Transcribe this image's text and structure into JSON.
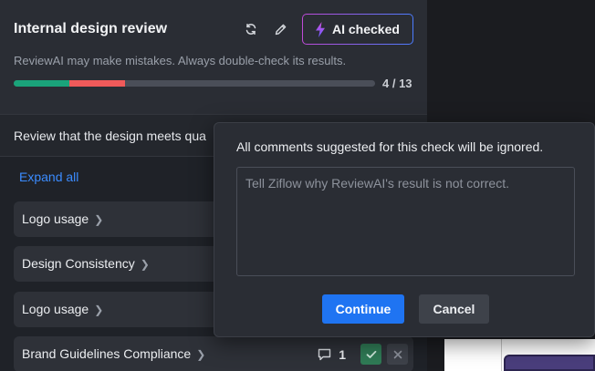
{
  "review": {
    "title": "Internal design review",
    "ai_badge_label": "AI checked",
    "disclaimer": "ReviewAI may make mistakes. Always double-check its results.",
    "progress": {
      "count_text": "4 / 13",
      "passed_fraction": 0.154,
      "failed_fraction": 0.154,
      "passed_color": "#1aa37a",
      "failed_color": "#f05a5a"
    },
    "check_text": "Review that the design meets qua",
    "expand_all_label": "Expand all",
    "items": [
      {
        "label": "Logo usage"
      },
      {
        "label": "Design Consistency"
      },
      {
        "label": "Logo usage"
      },
      {
        "label": "Brand Guidelines Compliance",
        "comment_count": "1"
      }
    ]
  },
  "popover": {
    "message": "All comments suggested for this check will be ignored.",
    "input_value": "",
    "input_placeholder": "Tell Ziflow why ReviewAI's result is not correct.",
    "continue_label": "Continue",
    "cancel_label": "Cancel"
  },
  "icons": {
    "refresh": "refresh-icon",
    "edit": "pencil-icon",
    "lightning": "lightning-icon",
    "chevron": "chevron-right-icon",
    "comment": "comment-icon",
    "check": "check-icon",
    "close": "close-icon"
  },
  "colors": {
    "accent_blue": "#1f74f2",
    "link_blue": "#3b8cff",
    "approve_green": "#2f7a55"
  }
}
